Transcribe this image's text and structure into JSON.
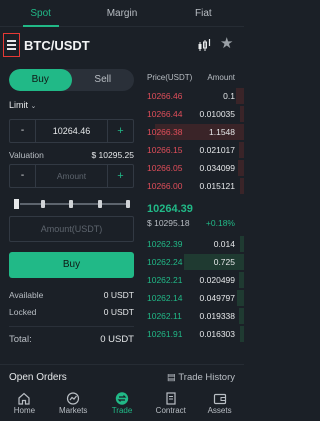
{
  "top_tabs": [
    "Spot",
    "Margin",
    "Fiat"
  ],
  "pair": "BTC/USDT",
  "trade": {
    "buy_label": "Buy",
    "sell_label": "Sell",
    "order_type": "Limit",
    "price_value": "10264.46",
    "valuation_label": "Valuation",
    "valuation_value": "$ 10295.25",
    "amount_placeholder": "Amount",
    "total_placeholder": "Amount(USDT)",
    "buy_button": "Buy",
    "available_label": "Available",
    "available_value": "0 USDT",
    "locked_label": "Locked",
    "locked_value": "0 USDT",
    "total_label": "Total:",
    "total_value": "0 USDT"
  },
  "order_book": {
    "price_header": "Price(USDT)",
    "amount_header": "Amount",
    "asks": [
      {
        "price": "10266.46",
        "amount": "0.1",
        "depth": 0.08
      },
      {
        "price": "10266.44",
        "amount": "0.010035",
        "depth": 0.04
      },
      {
        "price": "10266.38",
        "amount": "1.1548",
        "depth": 0.92
      },
      {
        "price": "10266.15",
        "amount": "0.021017",
        "depth": 0.05
      },
      {
        "price": "10266.05",
        "amount": "0.034099",
        "depth": 0.06
      },
      {
        "price": "10266.00",
        "amount": "0.015121",
        "depth": 0.04
      }
    ],
    "last_price": "10264.39",
    "last_price_usd": "$ 10295.18",
    "change": "+0.18%",
    "bids": [
      {
        "price": "10262.39",
        "amount": "0.014",
        "depth": 0.04
      },
      {
        "price": "10262.24",
        "amount": "0.725",
        "depth": 0.62
      },
      {
        "price": "10262.21",
        "amount": "0.020499",
        "depth": 0.05
      },
      {
        "price": "10262.14",
        "amount": "0.049797",
        "depth": 0.07
      },
      {
        "price": "10262.11",
        "amount": "0.019338",
        "depth": 0.05
      },
      {
        "price": "10261.91",
        "amount": "0.016303",
        "depth": 0.04
      }
    ]
  },
  "open_orders": {
    "title": "Open Orders",
    "history_label": "Trade History"
  },
  "nav": [
    {
      "label": "Home",
      "icon": "home-icon"
    },
    {
      "label": "Markets",
      "icon": "markets-icon"
    },
    {
      "label": "Trade",
      "icon": "trade-icon"
    },
    {
      "label": "Contract",
      "icon": "contract-icon"
    },
    {
      "label": "Assets",
      "icon": "assets-icon"
    }
  ],
  "colors": {
    "accent_green": "#21b987",
    "ask_red": "#e04e5a",
    "background": "#1b2027",
    "highlight_red": "#e53935"
  }
}
